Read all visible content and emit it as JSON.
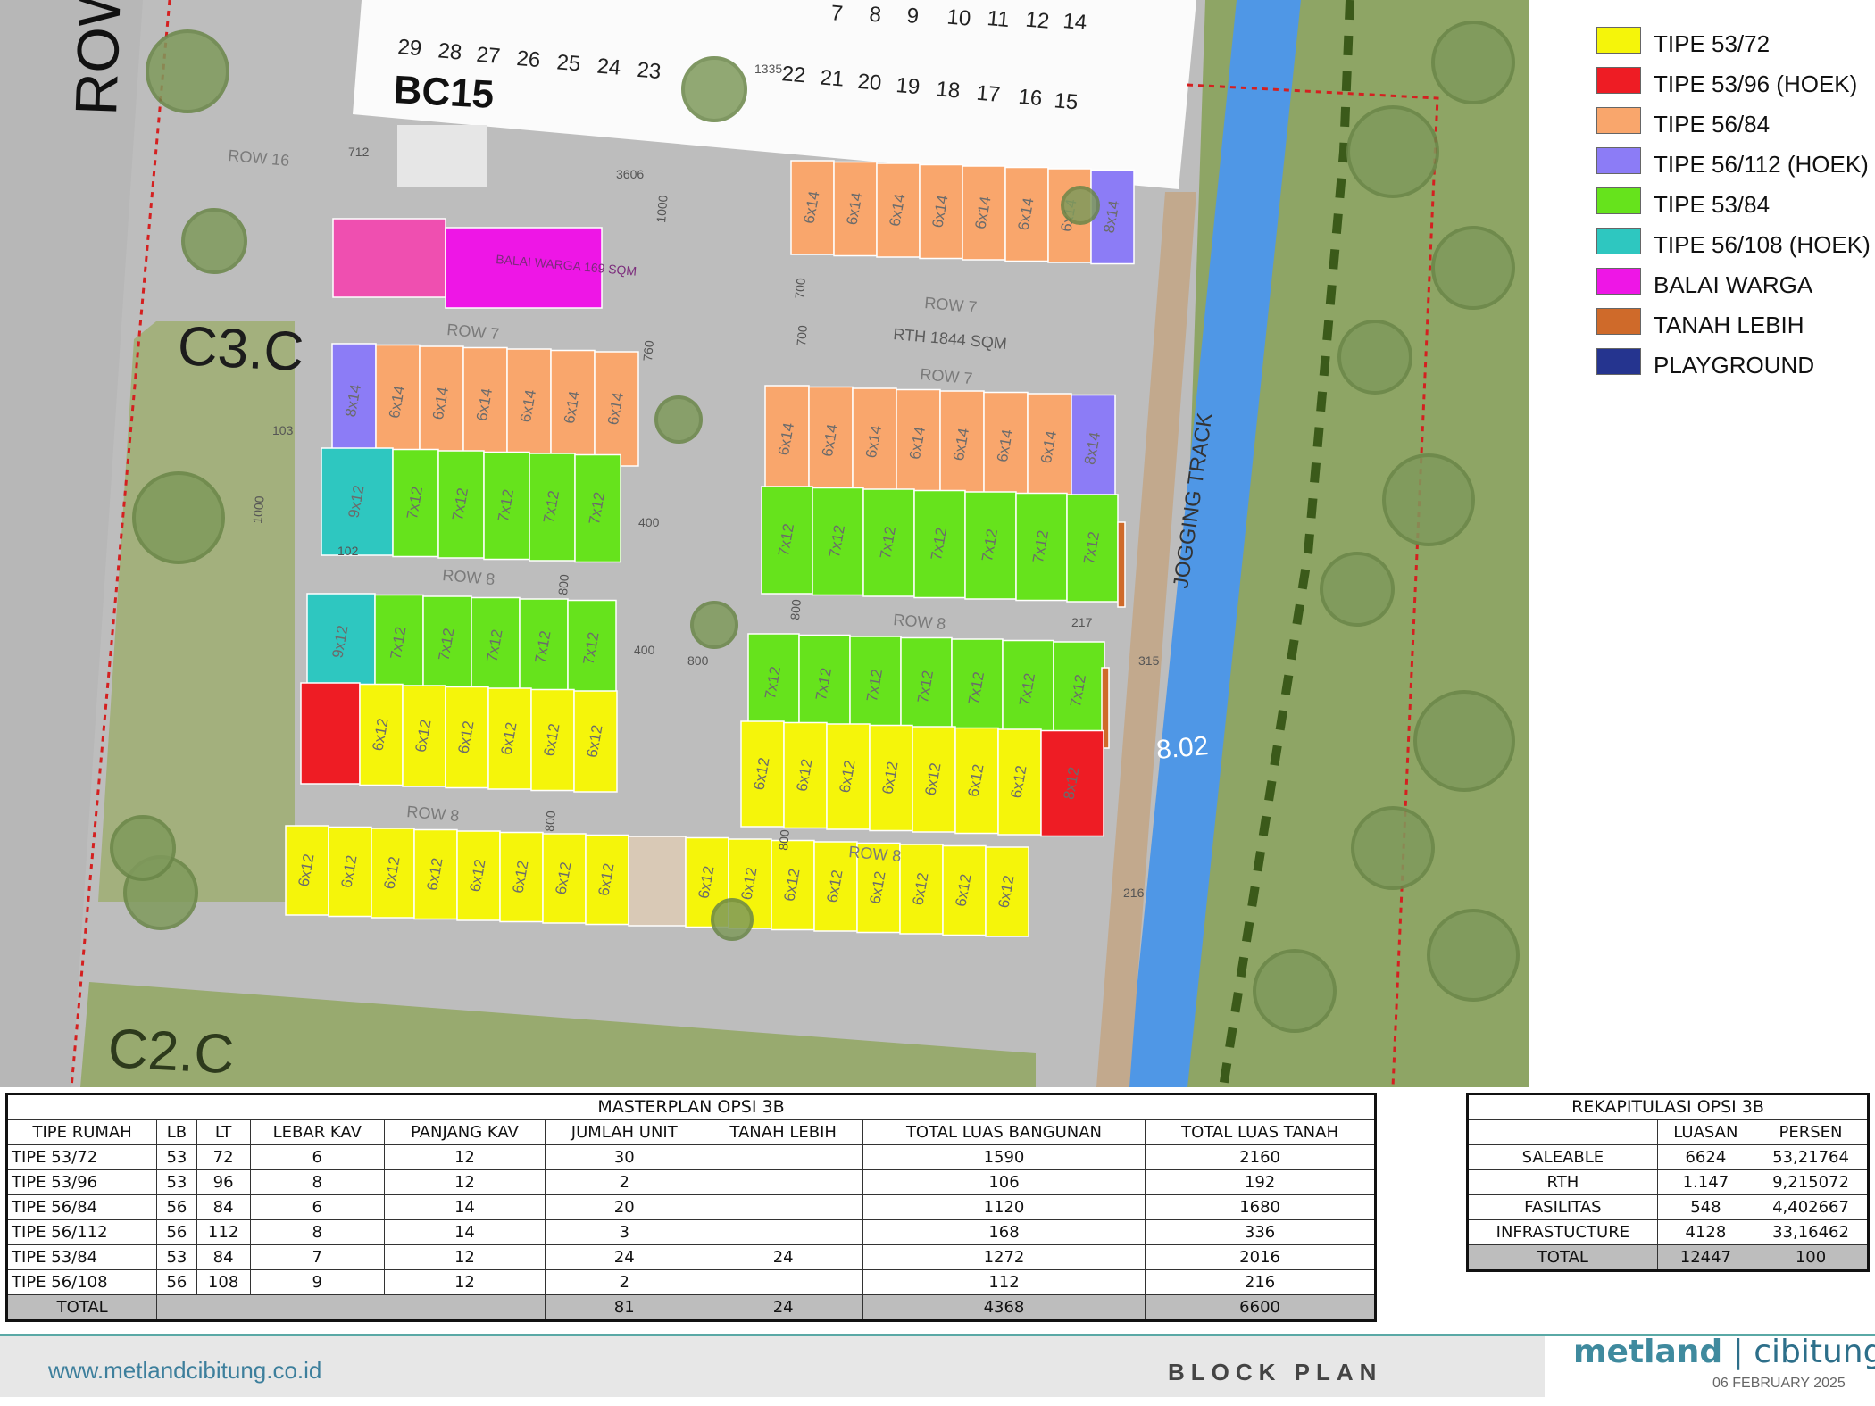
{
  "map": {
    "block_label": "BC15",
    "label_c3": "C3.C",
    "label_c2": "C2.C",
    "label_row_edge": "ROW",
    "jogging_track": "JOGGING TRACK",
    "channel_width": "8.02",
    "rth_label": "RTH 1844 SQM",
    "balai_label": "BALAI WARGA 169 SQM",
    "top_numbers": [
      "29",
      "28",
      "27",
      "26",
      "25",
      "24",
      "23",
      "22",
      "21",
      "20",
      "19",
      "18",
      "17",
      "16",
      "15"
    ],
    "top_numbers_upper": [
      "7",
      "8",
      "9",
      "10",
      "11",
      "12",
      "14"
    ],
    "row_labels": [
      "ROW 7",
      "ROW 7",
      "ROW 7",
      "ROW 8",
      "ROW 8",
      "ROW 8",
      "ROW 8",
      "ROW 16"
    ],
    "dims": [
      "712",
      "3606",
      "1000",
      "700",
      "700",
      "760",
      "800",
      "800",
      "800",
      "800",
      "800",
      "217",
      "315",
      "216",
      "102",
      "103",
      "1000",
      "400",
      "400",
      "1335"
    ],
    "lot_sizes": {
      "t5672": "6x12",
      "t5384": "7x12",
      "t5684": "6x14",
      "t56112": "8x14",
      "t56108": "9x12",
      "t5396": "8x12"
    }
  },
  "legend": [
    {
      "label": "TIPE 53/72",
      "color": "#f5f50a"
    },
    {
      "label": "TIPE 53/96 (HOEK)",
      "color": "#ee1c24"
    },
    {
      "label": "TIPE 56/84",
      "color": "#f9a66c"
    },
    {
      "label": "TIPE 56/112 (HOEK)",
      "color": "#8c7cf6"
    },
    {
      "label": "TIPE 53/84",
      "color": "#66e31c"
    },
    {
      "label": "TIPE 56/108 (HOEK)",
      "color": "#2ec7c0"
    },
    {
      "label": "BALAI WARGA",
      "color": "#ee16e6"
    },
    {
      "label": "TANAH LEBIH",
      "color": "#cf6a2a"
    },
    {
      "label": "PLAYGROUND",
      "color": "#25348f"
    }
  ],
  "masterplan": {
    "title": "MASTERPLAN OPSI 3B",
    "headers": [
      "TIPE RUMAH",
      "LB",
      "LT",
      "LEBAR KAV",
      "PANJANG KAV",
      "JUMLAH UNIT",
      "TANAH LEBIH",
      "TOTAL LUAS BANGUNAN",
      "TOTAL LUAS TANAH"
    ],
    "rows": [
      [
        "TIPE 53/72",
        "53",
        "72",
        "6",
        "12",
        "30",
        "",
        "1590",
        "2160"
      ],
      [
        "TIPE 53/96",
        "53",
        "96",
        "8",
        "12",
        "2",
        "",
        "106",
        "192"
      ],
      [
        "TIPE 56/84",
        "56",
        "84",
        "6",
        "14",
        "20",
        "",
        "1120",
        "1680"
      ],
      [
        "TIPE 56/112",
        "56",
        "112",
        "8",
        "14",
        "3",
        "",
        "168",
        "336"
      ],
      [
        "TIPE 53/84",
        "53",
        "84",
        "7",
        "12",
        "24",
        "24",
        "1272",
        "2016"
      ],
      [
        "TIPE 56/108",
        "56",
        "108",
        "9",
        "12",
        "2",
        "",
        "112",
        "216"
      ]
    ],
    "total": {
      "label": "TOTAL",
      "units": "81",
      "tanah_lebih": "24",
      "bangunan": "4368",
      "tanah": "6600"
    }
  },
  "rekap": {
    "title": "REKAPITULASI OPSI 3B",
    "headers": [
      "",
      "LUASAN",
      "PERSEN"
    ],
    "rows": [
      [
        "SALEABLE",
        "6624",
        "53,21764"
      ],
      [
        "RTH",
        "1.147",
        "9,215072"
      ],
      [
        "FASILITAS",
        "548",
        "4,402667"
      ],
      [
        "INFRASTUCTURE",
        "4128",
        "33,16462"
      ]
    ],
    "total": [
      "TOTAL",
      "12447",
      "100"
    ]
  },
  "footer": {
    "website": "www.metlandcibitung.co.id",
    "title": "BLOCK PLAN",
    "brand_left": "metland",
    "brand_sep": "|",
    "brand_right": "cibitung",
    "date": "06 FEBRUARY 2025"
  }
}
